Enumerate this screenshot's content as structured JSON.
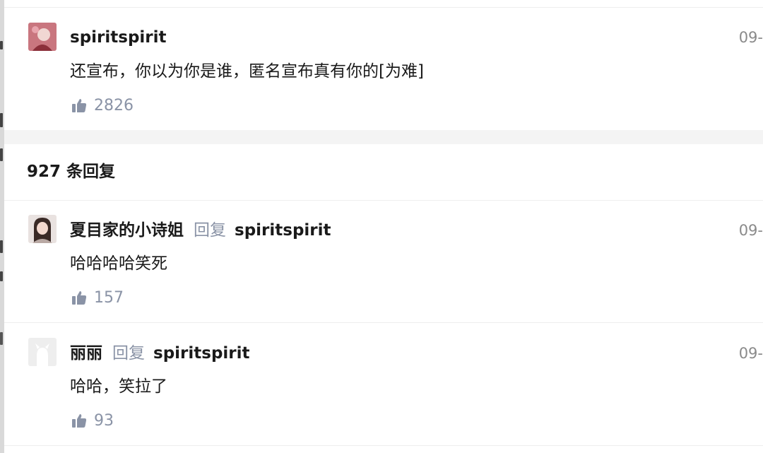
{
  "main_comment": {
    "username": "spiritspirit",
    "date": "09-",
    "content": "还宣布，你以为你是谁，匿名宣布真有你的[为难]",
    "likes": "2826",
    "avatar_icon": "user-avatar-icon"
  },
  "replies_section": {
    "count_label": "927 条回复"
  },
  "replies": [
    {
      "username": "夏目家的小诗姐",
      "reply_word": "回复",
      "reply_to": "spiritspirit",
      "date": "09-",
      "content": "哈哈哈哈笑死",
      "likes": "157",
      "avatar_icon": "user-avatar-icon"
    },
    {
      "username": "丽丽",
      "reply_word": "回复",
      "reply_to": "spiritspirit",
      "date": "09-",
      "content": "哈哈，笑拉了",
      "likes": "93",
      "avatar_icon": "default-avatar-icon"
    }
  ],
  "colors": {
    "secondary_text": "#8a93a6",
    "divider": "#eeeeee",
    "section_gap": "#f4f4f4"
  }
}
